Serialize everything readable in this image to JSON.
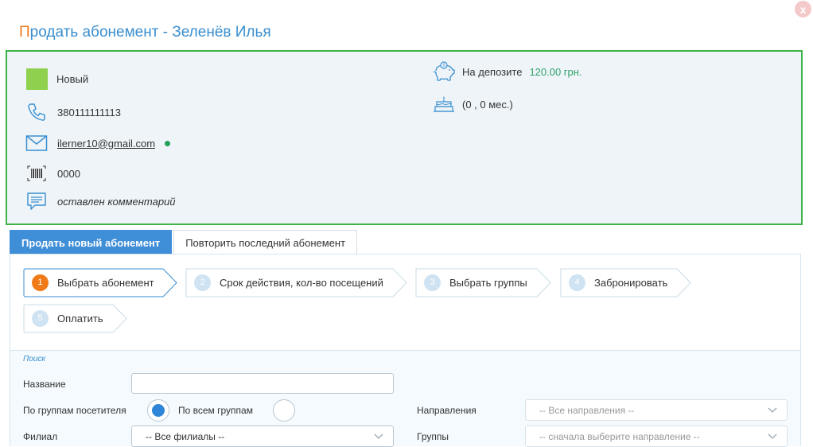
{
  "window": {
    "title_first_letter": "П",
    "title_rest": "родать абонемент - Зеленёв Илья",
    "close_label": "x"
  },
  "client": {
    "status": "Новый",
    "status_color": "#8fd14f",
    "phone": "380111111113",
    "email": "ilerner10@gmail.com",
    "card": "0000",
    "comment": "оставлен комментарий",
    "deposit_label": "На депозите",
    "deposit_amount": "120.00 грн.",
    "birthday": "(0 , 0 мес.)"
  },
  "tabs": [
    {
      "label": "Продать новый абонемент",
      "active": true
    },
    {
      "label": "Повторить последний абонемент",
      "active": false
    }
  ],
  "steps": [
    {
      "num": "1",
      "label": "Выбрать абонемент",
      "active": true
    },
    {
      "num": "2",
      "label": "Срок действия, кол-во посещений",
      "active": false
    },
    {
      "num": "3",
      "label": "Выбрать группы",
      "active": false
    },
    {
      "num": "4",
      "label": "Забронировать",
      "active": false
    },
    {
      "num": "5",
      "label": "Оплатить",
      "active": false
    }
  ],
  "search": {
    "caption": "Поиск",
    "name_label": "Название",
    "name_value": "",
    "radio_visitor_groups": "По группам посетителя",
    "radio_all_groups": "По всем группам",
    "radio_selected": "visitor_groups",
    "directions_label": "Направления",
    "directions_value": "-- Все направления --",
    "branch_label": "Филиал",
    "branch_value": "-- Все филиалы --",
    "groups_label": "Группы",
    "groups_value": "-- сначала выберите направление --"
  },
  "colors": {
    "accent": "#3a8fd0",
    "orange": "#f07a17",
    "frame_green": "#3db34a",
    "deposit_green": "#2fa36b"
  }
}
